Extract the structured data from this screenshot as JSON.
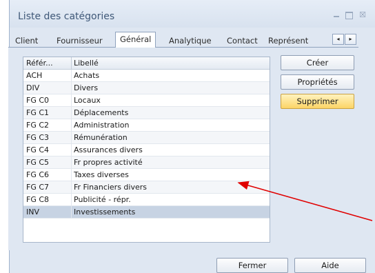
{
  "window": {
    "title": "Liste des catégories"
  },
  "tabs": [
    {
      "label": "Client",
      "active": false
    },
    {
      "label": "Fournisseur",
      "active": false
    },
    {
      "label": "Général",
      "active": true
    },
    {
      "label": "Analytique",
      "active": false
    },
    {
      "label": "Contact",
      "active": false
    },
    {
      "label": "Représent",
      "active": false
    }
  ],
  "tab_scroll": {
    "left": "◂",
    "right": "▸"
  },
  "list": {
    "columns": [
      "Référ...",
      "Libellé"
    ],
    "rows": [
      {
        "ref": "ACH",
        "label": "Achats"
      },
      {
        "ref": "DIV",
        "label": "Divers"
      },
      {
        "ref": "FG C0",
        "label": "Locaux"
      },
      {
        "ref": "FG C1",
        "label": "Déplacements"
      },
      {
        "ref": "FG C2",
        "label": "Administration"
      },
      {
        "ref": "FG C3",
        "label": "Rémunération"
      },
      {
        "ref": "FG C4",
        "label": "Assurances divers"
      },
      {
        "ref": "FG C5",
        "label": "Fr propres activité"
      },
      {
        "ref": "FG C6",
        "label": "Taxes diverses"
      },
      {
        "ref": "FG C7",
        "label": "Fr Financiers divers"
      },
      {
        "ref": "FG C8",
        "label": "Publicité - répr."
      },
      {
        "ref": "INV",
        "label": "Investissements"
      }
    ],
    "selected_index": 11
  },
  "buttons": {
    "create": "Créer",
    "properties": "Propriétés",
    "delete": "Supprimer",
    "close": "Fermer",
    "help": "Aide"
  },
  "colors": {
    "arrow": "#e00000",
    "primary_button": "#fcd466",
    "selected_row": "#c7d3e3"
  }
}
